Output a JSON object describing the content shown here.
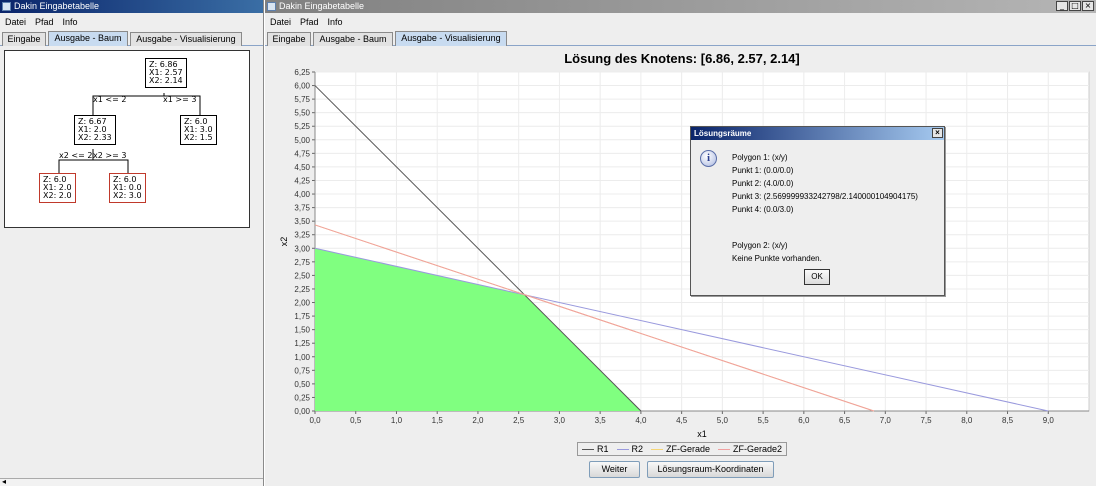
{
  "left_window": {
    "title": "Dakin Eingabetabelle",
    "menu": [
      "Datei",
      "Pfad",
      "Info"
    ],
    "tabs": [
      "Eingabe",
      "Ausgabe - Baum",
      "Ausgabe - Visualisierung"
    ],
    "selected_tab": "Ausgabe - Baum",
    "tree": {
      "root": {
        "z": "Z: 6.86",
        "x1": "X1: 2.57",
        "x2": "X2: 2.14"
      },
      "left_edge": "x1 <= 2",
      "right_edge": "x1 >= 3",
      "n1": {
        "z": "Z: 6.67",
        "x1": "X1: 2.0",
        "x2": "X2: 2.33"
      },
      "n2": {
        "z": "Z: 6.0",
        "x1": "X1: 3.0",
        "x2": "X2: 1.5"
      },
      "n1_left_edge": "x2 <= 2",
      "n1_right_edge": "x2 >= 3",
      "n3": {
        "z": "Z: 6.0",
        "x1": "X1: 2.0",
        "x2": "X2: 2.0"
      },
      "n4": {
        "z": "Z: 6.0",
        "x1": "X1: 0.0",
        "x2": "X2: 3.0"
      }
    }
  },
  "right_window": {
    "title": "Dakin Eingabetabelle",
    "window_buttons": [
      "_",
      "□",
      "×"
    ],
    "menu": [
      "Datei",
      "Pfad",
      "Info"
    ],
    "tabs": [
      "Eingabe",
      "Ausgabe - Baum",
      "Ausgabe - Visualisierung"
    ],
    "selected_tab": "Ausgabe - Visualisierung",
    "buttons": {
      "next": "Weiter",
      "coords": "Lösungsraum-Koordinaten"
    }
  },
  "dialog": {
    "title": "Lösungsräume",
    "close": "×",
    "lines": [
      "Polygon 1: (x/y)",
      "Punkt 1: (0.0/0.0)",
      "Punkt 2: (4.0/0.0)",
      "Punkt 3: (2.569999933242798/2.140000104904175)",
      "Punkt 4: (0.0/3.0)",
      "",
      "Polygon 2: (x/y)",
      "Keine Punkte vorhanden."
    ],
    "ok": "OK"
  },
  "colors": {
    "polygon": "#80ff80",
    "r1": "#555555",
    "r2": "#9999dd",
    "zf": "#f5d575",
    "zf2": "#f0a0a0"
  },
  "chart_data": {
    "type": "line",
    "title": "Lösung des Knotens: [6.86, 2.57, 2.14]",
    "xlabel": "x1",
    "ylabel": "x2",
    "xlim": [
      0,
      9.5
    ],
    "ylim": [
      0,
      6.25
    ],
    "xticks": [
      "0,0",
      "0,5",
      "1,0",
      "1,5",
      "2,0",
      "2,5",
      "3,0",
      "3,5",
      "4,0",
      "4,5",
      "5,0",
      "5,5",
      "6,0",
      "6,5",
      "7,0",
      "7,5",
      "8,0",
      "8,5",
      "9,0"
    ],
    "yticks": [
      "0,00",
      "0,25",
      "0,50",
      "0,75",
      "1,00",
      "1,25",
      "1,50",
      "1,75",
      "2,00",
      "2,25",
      "2,50",
      "2,75",
      "3,00",
      "3,25",
      "3,50",
      "3,75",
      "4,00",
      "4,25",
      "4,50",
      "4,75",
      "5,00",
      "5,25",
      "5,50",
      "5,75",
      "6,00",
      "6,25"
    ],
    "polygon": [
      [
        0,
        0
      ],
      [
        4.0,
        0
      ],
      [
        2.57,
        2.14
      ],
      [
        0,
        3.0
      ]
    ],
    "series": [
      {
        "name": "R1",
        "x": [
          0,
          4.0
        ],
        "y": [
          6.0,
          0
        ]
      },
      {
        "name": "R2",
        "x": [
          0,
          9.0
        ],
        "y": [
          3.0,
          0
        ]
      },
      {
        "name": "ZF-Gerade",
        "x": [
          0,
          6.86
        ],
        "y": [
          3.43,
          0
        ]
      },
      {
        "name": "ZF-Gerade2",
        "x": [
          0,
          6.86
        ],
        "y": [
          3.43,
          0
        ]
      }
    ],
    "legend": "bottom-center",
    "grid": true
  }
}
